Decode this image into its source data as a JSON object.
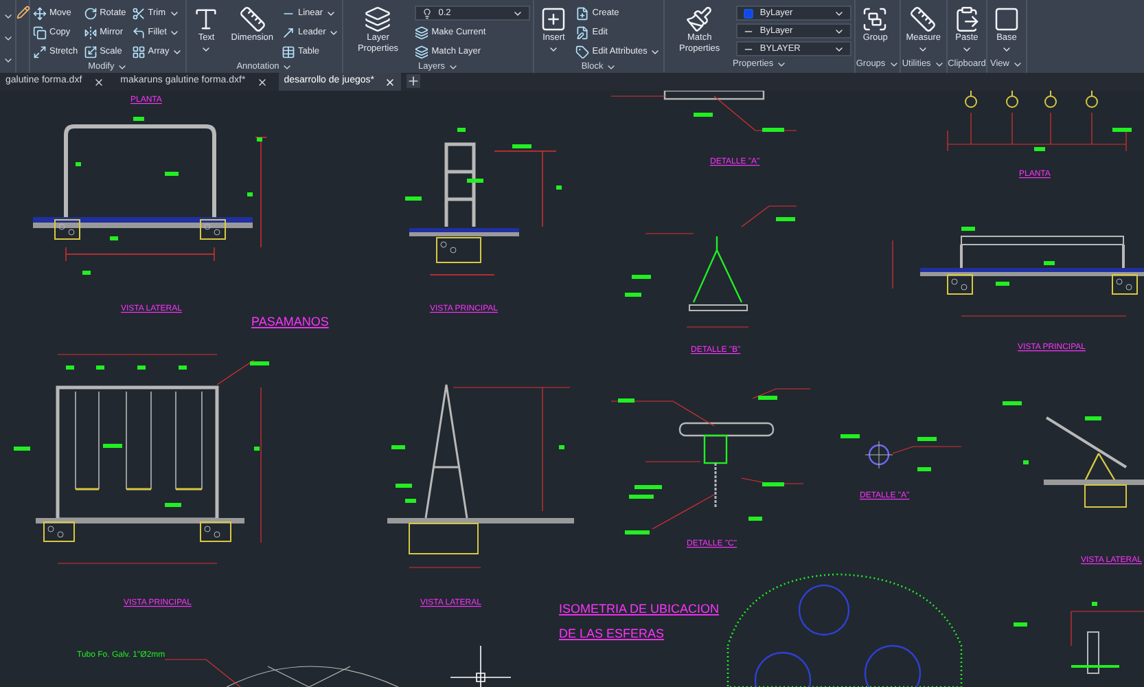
{
  "ribbon": {
    "panels": [
      {
        "title": "Modify",
        "menu": true,
        "tools": [
          {
            "label": "Move",
            "kind": "small",
            "dropdown": false
          },
          {
            "label": "Copy",
            "kind": "small",
            "dropdown": false
          },
          {
            "label": "Stretch",
            "kind": "small",
            "dropdown": false
          },
          {
            "label": "Rotate",
            "kind": "small",
            "dropdown": false
          },
          {
            "label": "Mirror",
            "kind": "small",
            "dropdown": false
          },
          {
            "label": "Scale",
            "kind": "small",
            "dropdown": false
          },
          {
            "label": "Trim",
            "kind": "small",
            "dropdown": true
          },
          {
            "label": "Fillet",
            "kind": "small",
            "dropdown": true
          },
          {
            "label": "Array",
            "kind": "small",
            "dropdown": true
          }
        ]
      },
      {
        "title": "Annotation",
        "menu": true,
        "tools": [
          {
            "label": "Text",
            "kind": "large",
            "dropdown": true
          },
          {
            "label": "Dimension",
            "kind": "large",
            "dropdown": false
          },
          {
            "label": "Linear",
            "kind": "small",
            "dropdown": true
          },
          {
            "label": "Leader",
            "kind": "small",
            "dropdown": true
          },
          {
            "label": "Table",
            "kind": "small",
            "dropdown": false
          }
        ]
      },
      {
        "title": "Layers",
        "menu": true,
        "tools": [
          {
            "label": "Layer Properties",
            "kind": "large",
            "dropdown": false
          },
          {
            "label": "0.2",
            "kind": "dropdown",
            "dropdown": true
          },
          {
            "label": "Make Current",
            "kind": "small",
            "dropdown": false
          },
          {
            "label": "Match Layer",
            "kind": "small",
            "dropdown": false
          }
        ]
      },
      {
        "title": "Block",
        "menu": true,
        "tools": [
          {
            "label": "Insert",
            "kind": "large",
            "dropdown": true
          },
          {
            "label": "Create",
            "kind": "small",
            "dropdown": false
          },
          {
            "label": "Edit",
            "kind": "small",
            "dropdown": false
          },
          {
            "label": "Edit Attributes",
            "kind": "small",
            "dropdown": true
          }
        ]
      },
      {
        "title": "Properties",
        "menu": true,
        "tools": [
          {
            "label": "Match Properties",
            "kind": "large",
            "dropdown": false
          },
          {
            "label": "ByLayer",
            "kind": "dropdown",
            "dropdown": true
          },
          {
            "label": "ByLayer",
            "kind": "dropdown",
            "dropdown": true
          },
          {
            "label": "BYLAYER",
            "kind": "dropdown",
            "dropdown": true
          }
        ]
      },
      {
        "title": "Groups",
        "menu": true,
        "tools": [
          {
            "label": "Group",
            "kind": "large",
            "dropdown": false
          }
        ]
      },
      {
        "title": "Utilities",
        "menu": true,
        "tools": [
          {
            "label": "Measure",
            "kind": "large",
            "dropdown": true
          }
        ]
      },
      {
        "title": "Clipboard",
        "menu": false,
        "tools": [
          {
            "label": "Paste",
            "kind": "large",
            "dropdown": true
          }
        ]
      },
      {
        "title": "View",
        "menu": true,
        "tools": [
          {
            "label": "Base",
            "kind": "large",
            "dropdown": true
          }
        ]
      }
    ]
  },
  "document_tabs": [
    {
      "label": "galutine forma.dxf",
      "selected": false
    },
    {
      "label": "makaruns galutine forma.dxf*",
      "selected": false
    },
    {
      "label": "desarrollo de juegos*",
      "selected": true
    }
  ],
  "drawing": {
    "labels": [
      {
        "text": "PLANTA",
        "kind": "view-title"
      },
      {
        "text": "VISTA LATERAL",
        "kind": "view-title"
      },
      {
        "text": "PASAMANOS",
        "kind": "heading"
      },
      {
        "text": "VISTA PRINCIPAL",
        "kind": "view-title"
      },
      {
        "text": "DETALLE \"A\"",
        "kind": "view-title"
      },
      {
        "text": "PLANTA",
        "kind": "view-title"
      },
      {
        "text": "DETALLE \"B\"",
        "kind": "view-title"
      },
      {
        "text": "VISTA PRINCIPAL",
        "kind": "view-title"
      },
      {
        "text": "VISTA PRINCIPAL",
        "kind": "view-title"
      },
      {
        "text": "VISTA LATERAL",
        "kind": "view-title"
      },
      {
        "text": "DETALLE \"C\"",
        "kind": "view-title"
      },
      {
        "text": "DETALLE \"A\"",
        "kind": "view-title"
      },
      {
        "text": "VISTA LATERAL",
        "kind": "view-title"
      },
      {
        "text": "ISOMETRIA DE UBICACION",
        "kind": "heading"
      },
      {
        "text": "DE LAS ESFERAS",
        "kind": "heading"
      },
      {
        "text": "Tubo Fo. Galv. 1\"Ø2mm",
        "kind": "note"
      }
    ]
  }
}
